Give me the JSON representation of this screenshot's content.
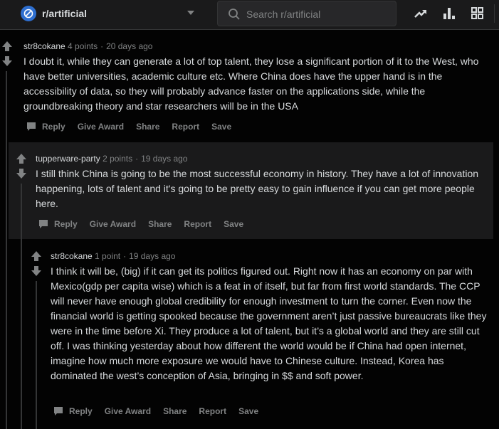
{
  "header": {
    "community": "r/artificial",
    "search_placeholder": "Search r/artificial"
  },
  "comments": [
    {
      "author": "str8cokane",
      "score": "4 points",
      "age": "20 days ago",
      "body": "I doubt it, while they can generate a lot of top talent, they lose a significant portion of it to the West, who have better universities, academic culture etc. Where China does have the upper hand is in the accessibility of data, so they will probably advance faster on the applications side, while the groundbreaking theory and star researchers will be in the USA"
    },
    {
      "author": "tupperware-party",
      "score": "2 points",
      "age": "19 days ago",
      "body": "I still think China is going to be the most successful economy in history. They have a lot of innovation happening, lots of talent and it's going to be pretty easy to gain influence if you can get more people here."
    },
    {
      "author": "str8cokane",
      "score": "1 point",
      "age": "19 days ago",
      "body": "I think it will be, (big) if it can get its politics figured out. Right now it has an economy on par with Mexico(gdp per capita wise) which is a feat in of itself, but far from first world standards. The CCP will never have enough global credibility for enough investment to turn the corner. Even now the financial world is getting spooked because the government aren’t just passive bureaucrats like they were in the time before Xi. They produce a lot of talent, but it’s a global world and they are still cut off. I was thinking yesterday about how different the world would be if China had open internet, imagine how much more exposure we would have to Chinese culture. Instead, Korea has dominated the west’s conception of Asia, bringing in $$ and soft power."
    }
  ],
  "actions": {
    "reply": "Reply",
    "give_award": "Give Award",
    "share": "Share",
    "report": "Report",
    "save": "Save"
  }
}
